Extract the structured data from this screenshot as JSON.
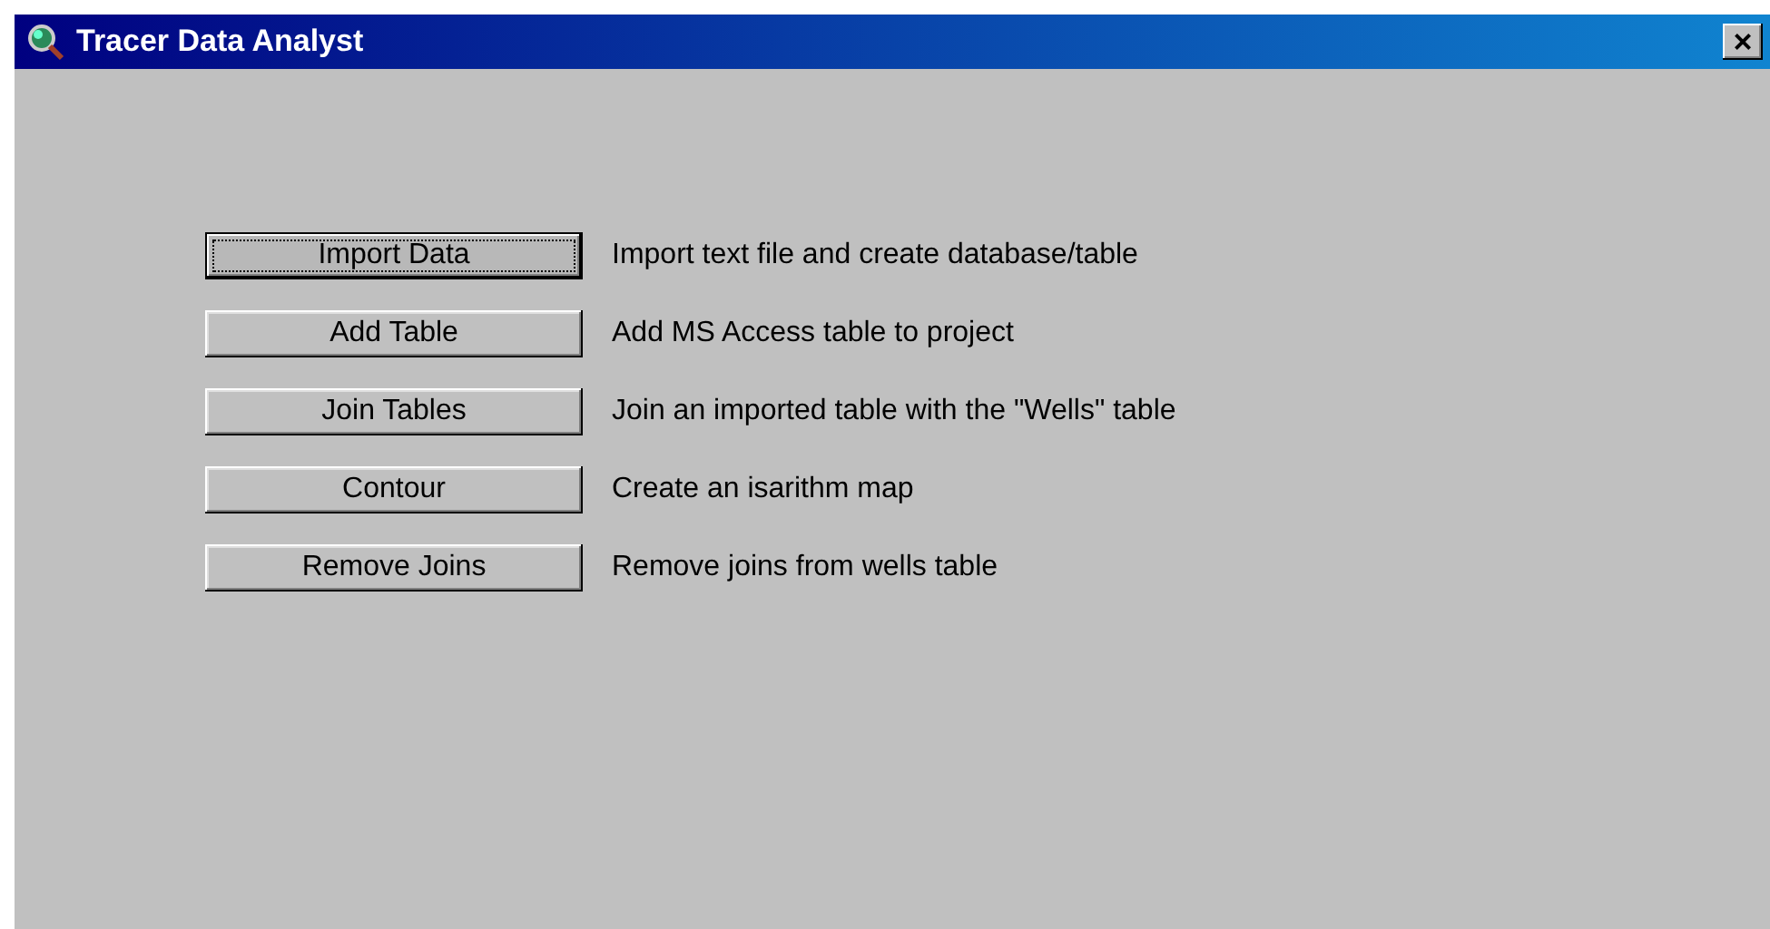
{
  "window": {
    "title": "Tracer Data Analyst",
    "close": "×"
  },
  "actions": [
    {
      "button": "Import Data",
      "description": "Import text file and create database/table",
      "focused": true
    },
    {
      "button": "Add Table",
      "description": "Add MS Access table to project",
      "focused": false
    },
    {
      "button": "Join Tables",
      "description": "Join an imported table with the \"Wells\" table",
      "focused": false
    },
    {
      "button": "Contour",
      "description": "Create an isarithm map",
      "focused": false
    },
    {
      "button": "Remove Joins",
      "description": "Remove joins from wells table",
      "focused": false
    }
  ]
}
